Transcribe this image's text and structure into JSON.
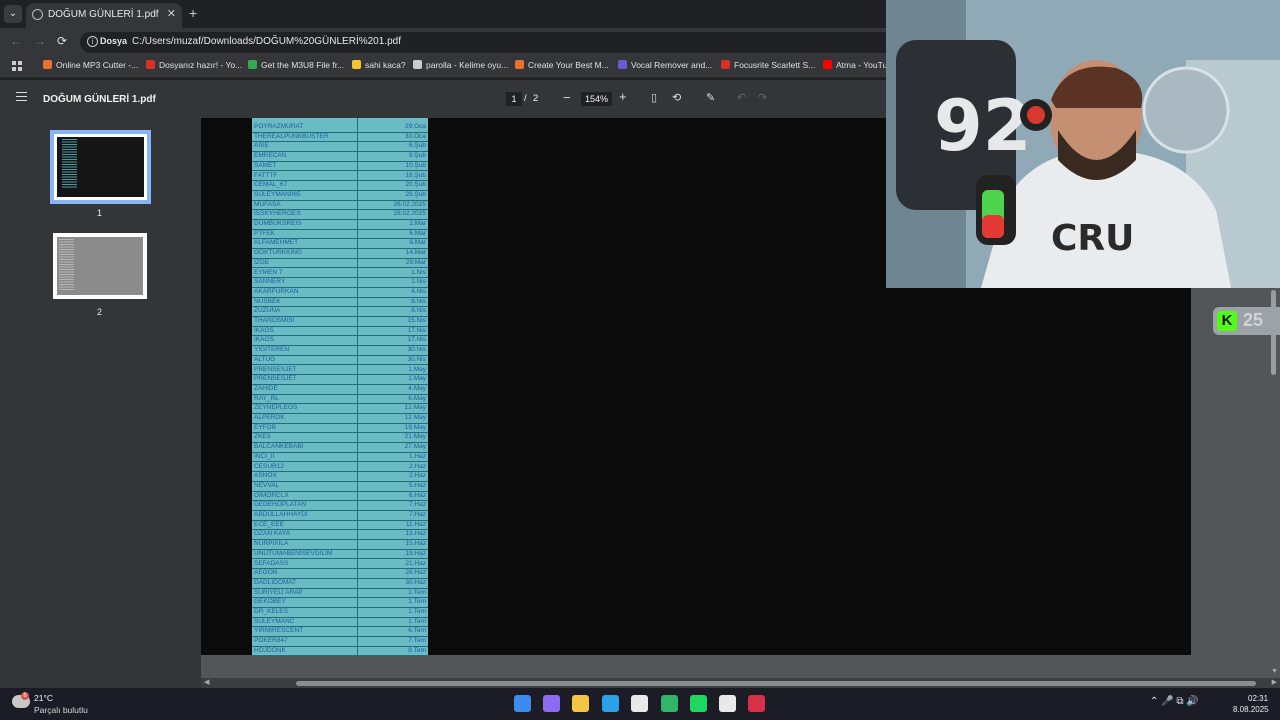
{
  "browser": {
    "tab_title": "DOĞUM GÜNLERİ 1.pdf",
    "tab_close": "✕",
    "new_tab": "+",
    "back": "←",
    "forward": "→",
    "reload": "⟳",
    "chip": "Dosya",
    "url": "C:/Users/muzaf/Downloads/DOĞUM%20GÜNLERİ%201.pdf",
    "bookmarks": [
      {
        "label": "Online MP3 Cutter -...",
        "color": "#e8712e"
      },
      {
        "label": "Dosyanız hazır! - Yo...",
        "color": "#d93025"
      },
      {
        "label": "Get the M3U8 File fr...",
        "color": "#34a853"
      },
      {
        "label": "sahi kaca?",
        "color": "#f4c430"
      },
      {
        "label": "parolla - Kelime oyu...",
        "color": "#cccccc"
      },
      {
        "label": "Create Your Best M...",
        "color": "#e8712e"
      },
      {
        "label": "Vocal Remover and...",
        "color": "#6b5bd2"
      },
      {
        "label": "Focusrite Scarlett S...",
        "color": "#d93025"
      },
      {
        "label": "Atma - YouTu",
        "color": "#ff0000"
      }
    ]
  },
  "pdf": {
    "title": "DOĞUM GÜNLERİ 1.pdf",
    "page_current": "1",
    "page_sep": "/",
    "page_total": "2",
    "zoom_out": "−",
    "zoom": "154%",
    "zoom_in": "+",
    "thumbnails": [
      "1",
      "2"
    ],
    "rows": [
      {
        "name": "POYRAZMURAT",
        "date": "29.Oca"
      },
      {
        "name": "THEREALPUNKBUSTER",
        "date": "30.Oca"
      },
      {
        "name": "AİSE",
        "date": "6.Şub"
      },
      {
        "name": "EMRECAN",
        "date": "9.Şub"
      },
      {
        "name": "SAMET",
        "date": "10.Şub"
      },
      {
        "name": "FATTTF",
        "date": "18.Şub"
      },
      {
        "name": "CEMAL_67",
        "date": "20.Şub"
      },
      {
        "name": "SÜLEYMAN065",
        "date": "26.Şub"
      },
      {
        "name": "MUFASA",
        "date": "28.02.2025"
      },
      {
        "name": "ISSKYHEROES",
        "date": "28.02.2025"
      },
      {
        "name": "DUMBUKSREİS",
        "date": "2.Mar"
      },
      {
        "name": "PTFEK",
        "date": "6.Mar"
      },
      {
        "name": "ALFAMEHMET",
        "date": "6.Mar"
      },
      {
        "name": "GÖKTÜRKKING",
        "date": "14.Mar"
      },
      {
        "name": "IZGE",
        "date": "29.Mar"
      },
      {
        "name": "EYMEN 7",
        "date": "1.Nis"
      },
      {
        "name": "SANNERY",
        "date": "1.Nis"
      },
      {
        "name": "AKARFURKAN",
        "date": "4.Nis"
      },
      {
        "name": "NUSBEK",
        "date": "8.Nis"
      },
      {
        "name": "ZUZUNA",
        "date": "8.Nis"
      },
      {
        "name": "THANOSMISI",
        "date": "15.Nis"
      },
      {
        "name": "İKAOS",
        "date": "17.Nis"
      },
      {
        "name": "İKAOS",
        "date": "17.Nis"
      },
      {
        "name": "YİĞİTEREN",
        "date": "30.Nis"
      },
      {
        "name": "ALTUĞ",
        "date": "30.Nis"
      },
      {
        "name": "PRENSESJET",
        "date": "1.May"
      },
      {
        "name": "PRENSESJET",
        "date": "1.May"
      },
      {
        "name": "ZAHİDE",
        "date": "4.May"
      },
      {
        "name": "RAY_RL",
        "date": "6.May"
      },
      {
        "name": "ZEYNEPLEOS",
        "date": "12.May"
      },
      {
        "name": "ALPEROK",
        "date": "12.May"
      },
      {
        "name": "EYFOB",
        "date": "19.May"
      },
      {
        "name": "ZKE3",
        "date": "21.May"
      },
      {
        "name": "BALCANKEBABI",
        "date": "27.May"
      },
      {
        "name": "İNCİ_İİ",
        "date": "1.Haz"
      },
      {
        "name": "CESUR12",
        "date": "2.Haz"
      },
      {
        "name": "ASNOX",
        "date": "2.Haz"
      },
      {
        "name": "NEVVAL",
        "date": "5.Haz"
      },
      {
        "name": "OİMORCLX",
        "date": "6.Haz"
      },
      {
        "name": "DEDEHOPLATAN",
        "date": "7.Haz"
      },
      {
        "name": "ABDULLAHHAYDI",
        "date": "7.Haz"
      },
      {
        "name": "ECE_EEE",
        "date": "11.Haz"
      },
      {
        "name": "OZAN KAYA",
        "date": "13.Haz"
      },
      {
        "name": "NURPIXILA",
        "date": "15.Haz"
      },
      {
        "name": "UNUTUMABENİSEVGİLİM",
        "date": "19.Haz"
      },
      {
        "name": "SEFADASS",
        "date": "21.Haz"
      },
      {
        "name": "AEGON",
        "date": "28.Haz"
      },
      {
        "name": "DADLIDOMAT",
        "date": "30.Haz"
      },
      {
        "name": "SURİYELİ ARAP",
        "date": "1.Tem"
      },
      {
        "name": "GEKOBEY",
        "date": "1.Tem"
      },
      {
        "name": "DR_KELES",
        "date": "1.Tem"
      },
      {
        "name": "SÜLEYMANC",
        "date": "1.Tem"
      },
      {
        "name": "YIRMIRESCENT",
        "date": "6.Tem"
      },
      {
        "name": "POKER847",
        "date": "7.Tem"
      },
      {
        "name": "HOJDONK",
        "date": "8.Tem"
      }
    ]
  },
  "overlay": {
    "kick_logo": "K",
    "kick_count": "25"
  },
  "taskbar": {
    "weather_badge": "6",
    "temperature": "21°C",
    "weather": "Parçalı bulutlu",
    "apps": [
      {
        "name": "windows-start-icon",
        "color": "#3b8ced"
      },
      {
        "name": "copilot-icon",
        "color": "#8b6cf0"
      },
      {
        "name": "file-explorer-icon",
        "color": "#f4c542"
      },
      {
        "name": "edge-icon",
        "color": "#2aa1e8"
      },
      {
        "name": "store-icon",
        "color": "#e8e8e8"
      },
      {
        "name": "tracker-app-icon",
        "color": "#31b568"
      },
      {
        "name": "spotify-icon",
        "color": "#1ed760"
      },
      {
        "name": "chrome-icon",
        "color": "#e8e8e8"
      },
      {
        "name": "media-app-icon",
        "color": "#d9304a"
      }
    ],
    "tray": "⌃   🎤   ⧉   🔊",
    "time": "02:31",
    "date": "8.08.2025"
  }
}
